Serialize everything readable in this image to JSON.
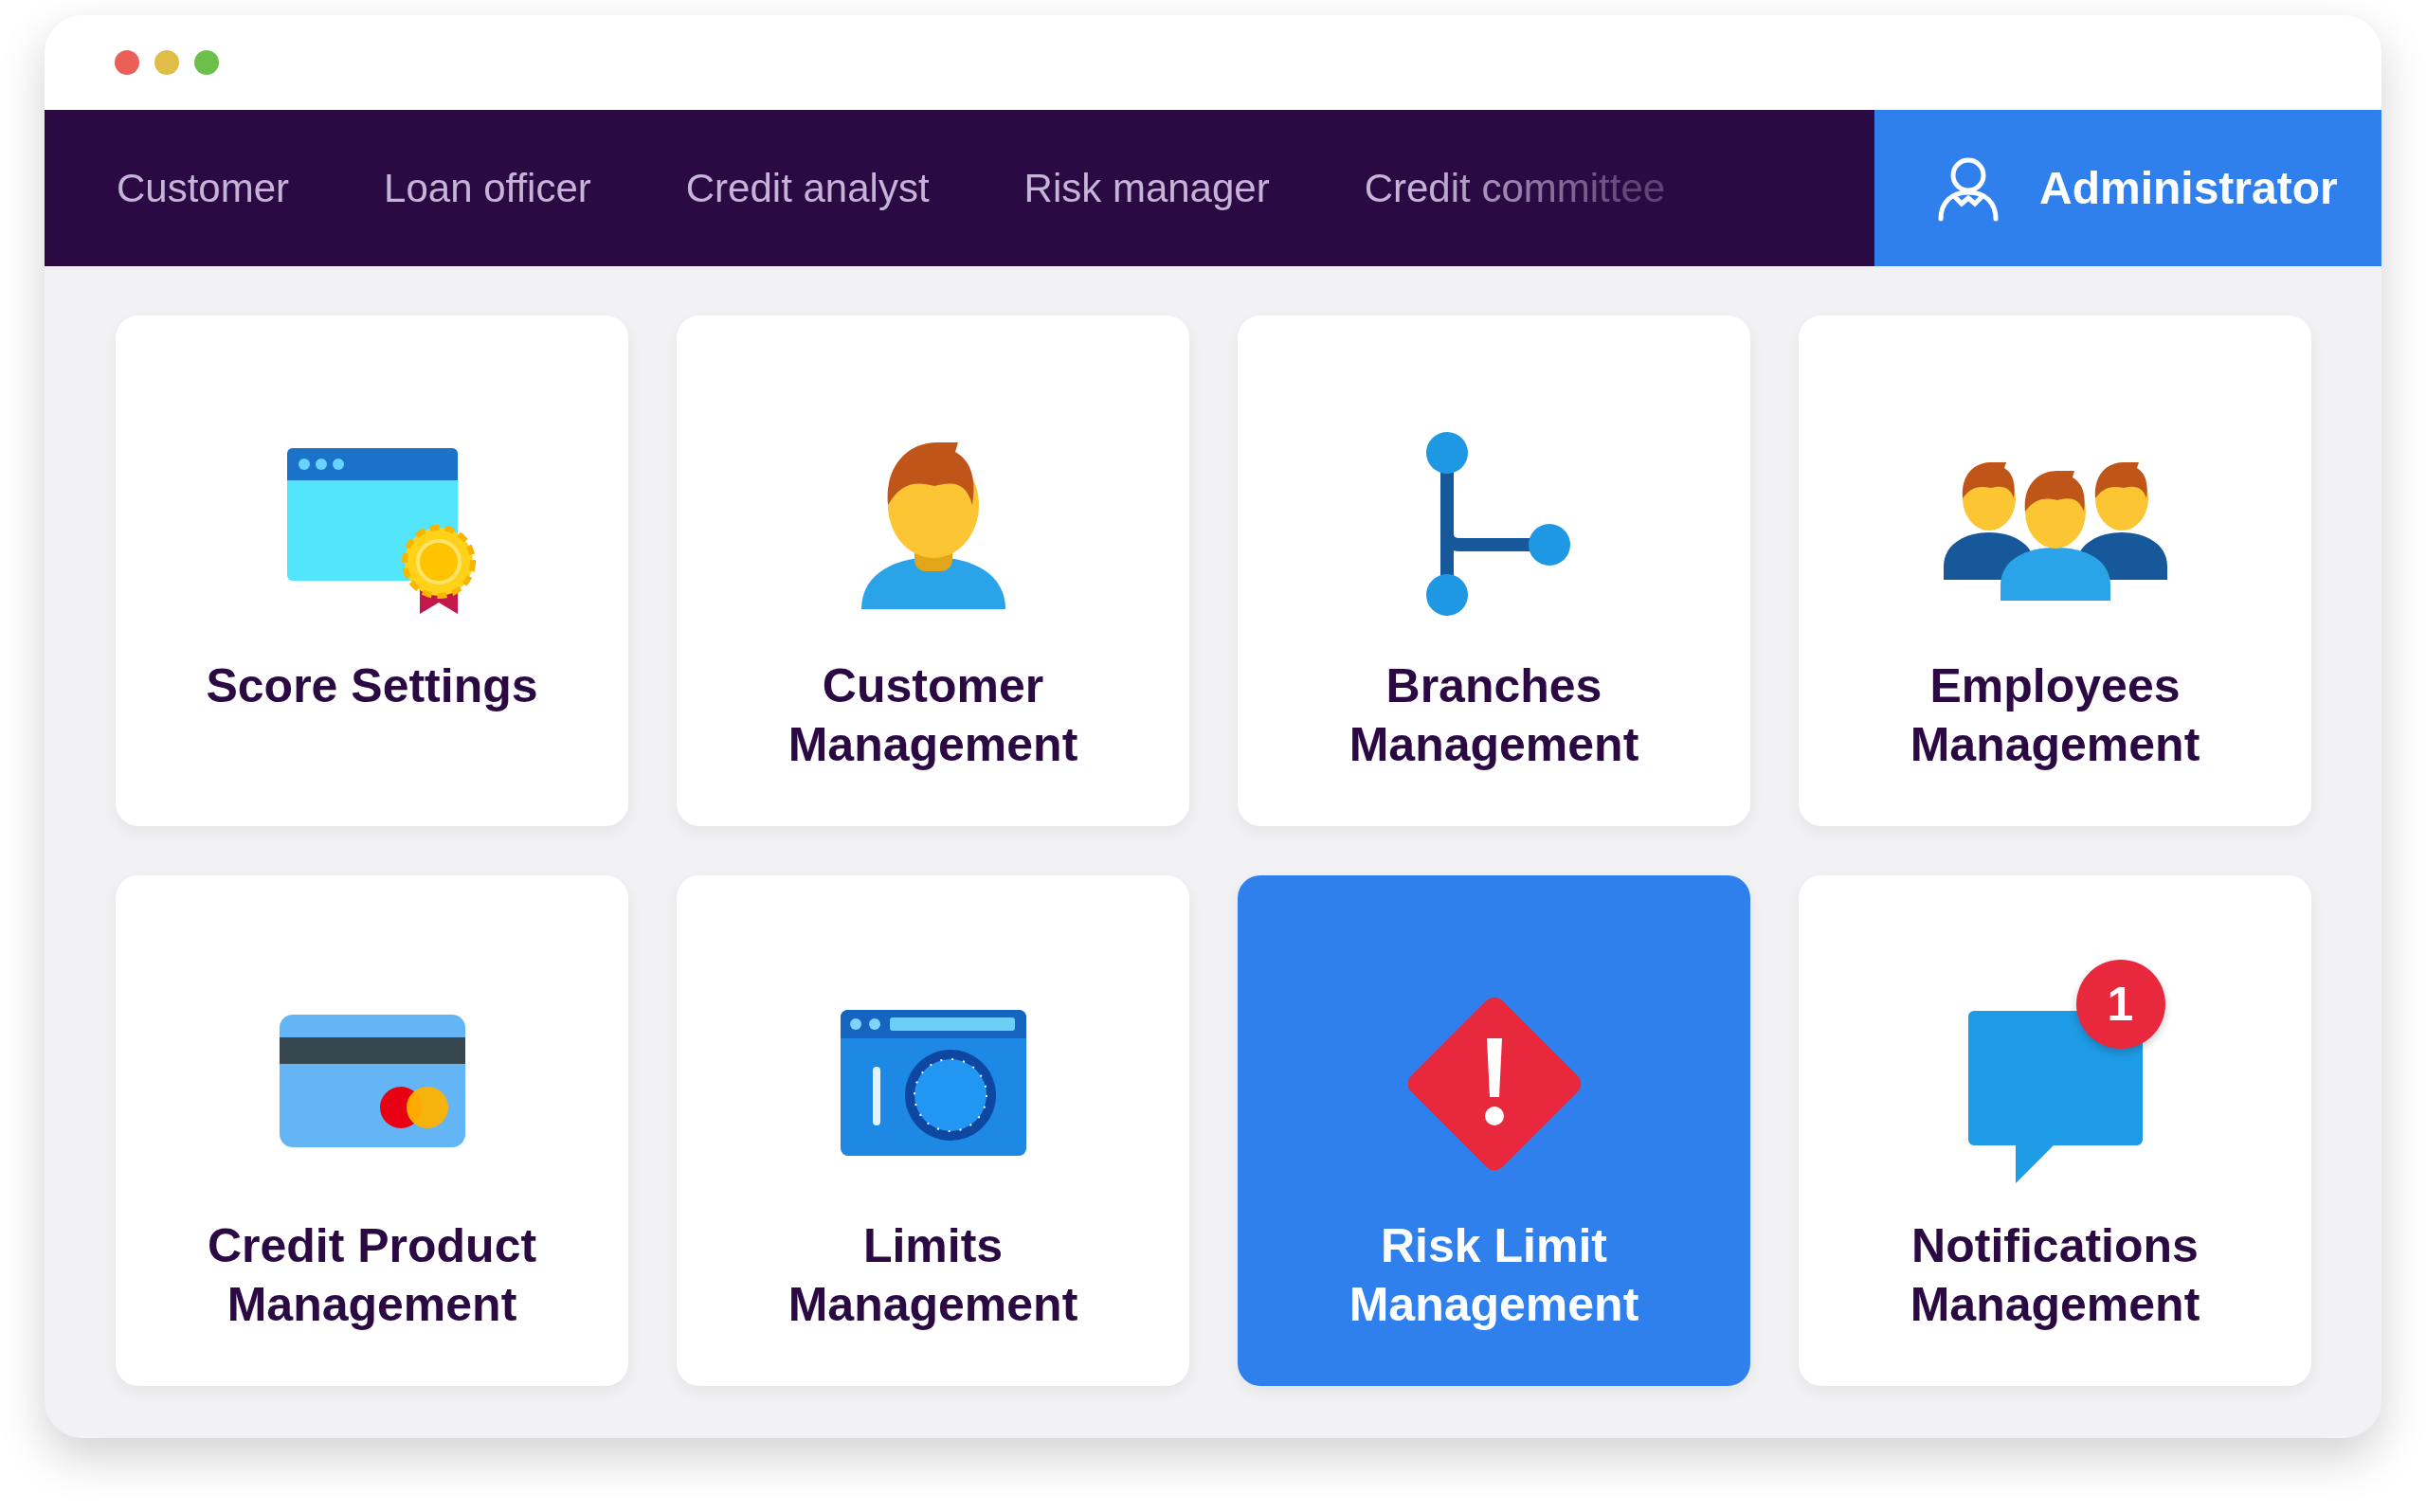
{
  "tabs": [
    {
      "label": "Customer",
      "selected": false
    },
    {
      "label": "Loan officer",
      "selected": false
    },
    {
      "label": "Credit analyst",
      "selected": false
    },
    {
      "label": "Risk manager",
      "selected": false
    },
    {
      "label": "Credit committee",
      "selected": false
    },
    {
      "label": "Administrator",
      "selected": true
    }
  ],
  "cards": [
    {
      "kind": "score",
      "title": "Score Settings",
      "selected": false
    },
    {
      "kind": "customer",
      "title": "Customer Management",
      "selected": false
    },
    {
      "kind": "branches",
      "title": "Branches Management",
      "selected": false
    },
    {
      "kind": "employees",
      "title": "Employees Management",
      "selected": false
    },
    {
      "kind": "credit",
      "title": "Credit Product Management",
      "selected": false
    },
    {
      "kind": "limits",
      "title": "Limits Management",
      "selected": false
    },
    {
      "kind": "risk",
      "title": "Risk Limit Management",
      "selected": true
    },
    {
      "kind": "notifications",
      "title": "Notifications Management",
      "selected": false,
      "badge": "1"
    }
  ]
}
